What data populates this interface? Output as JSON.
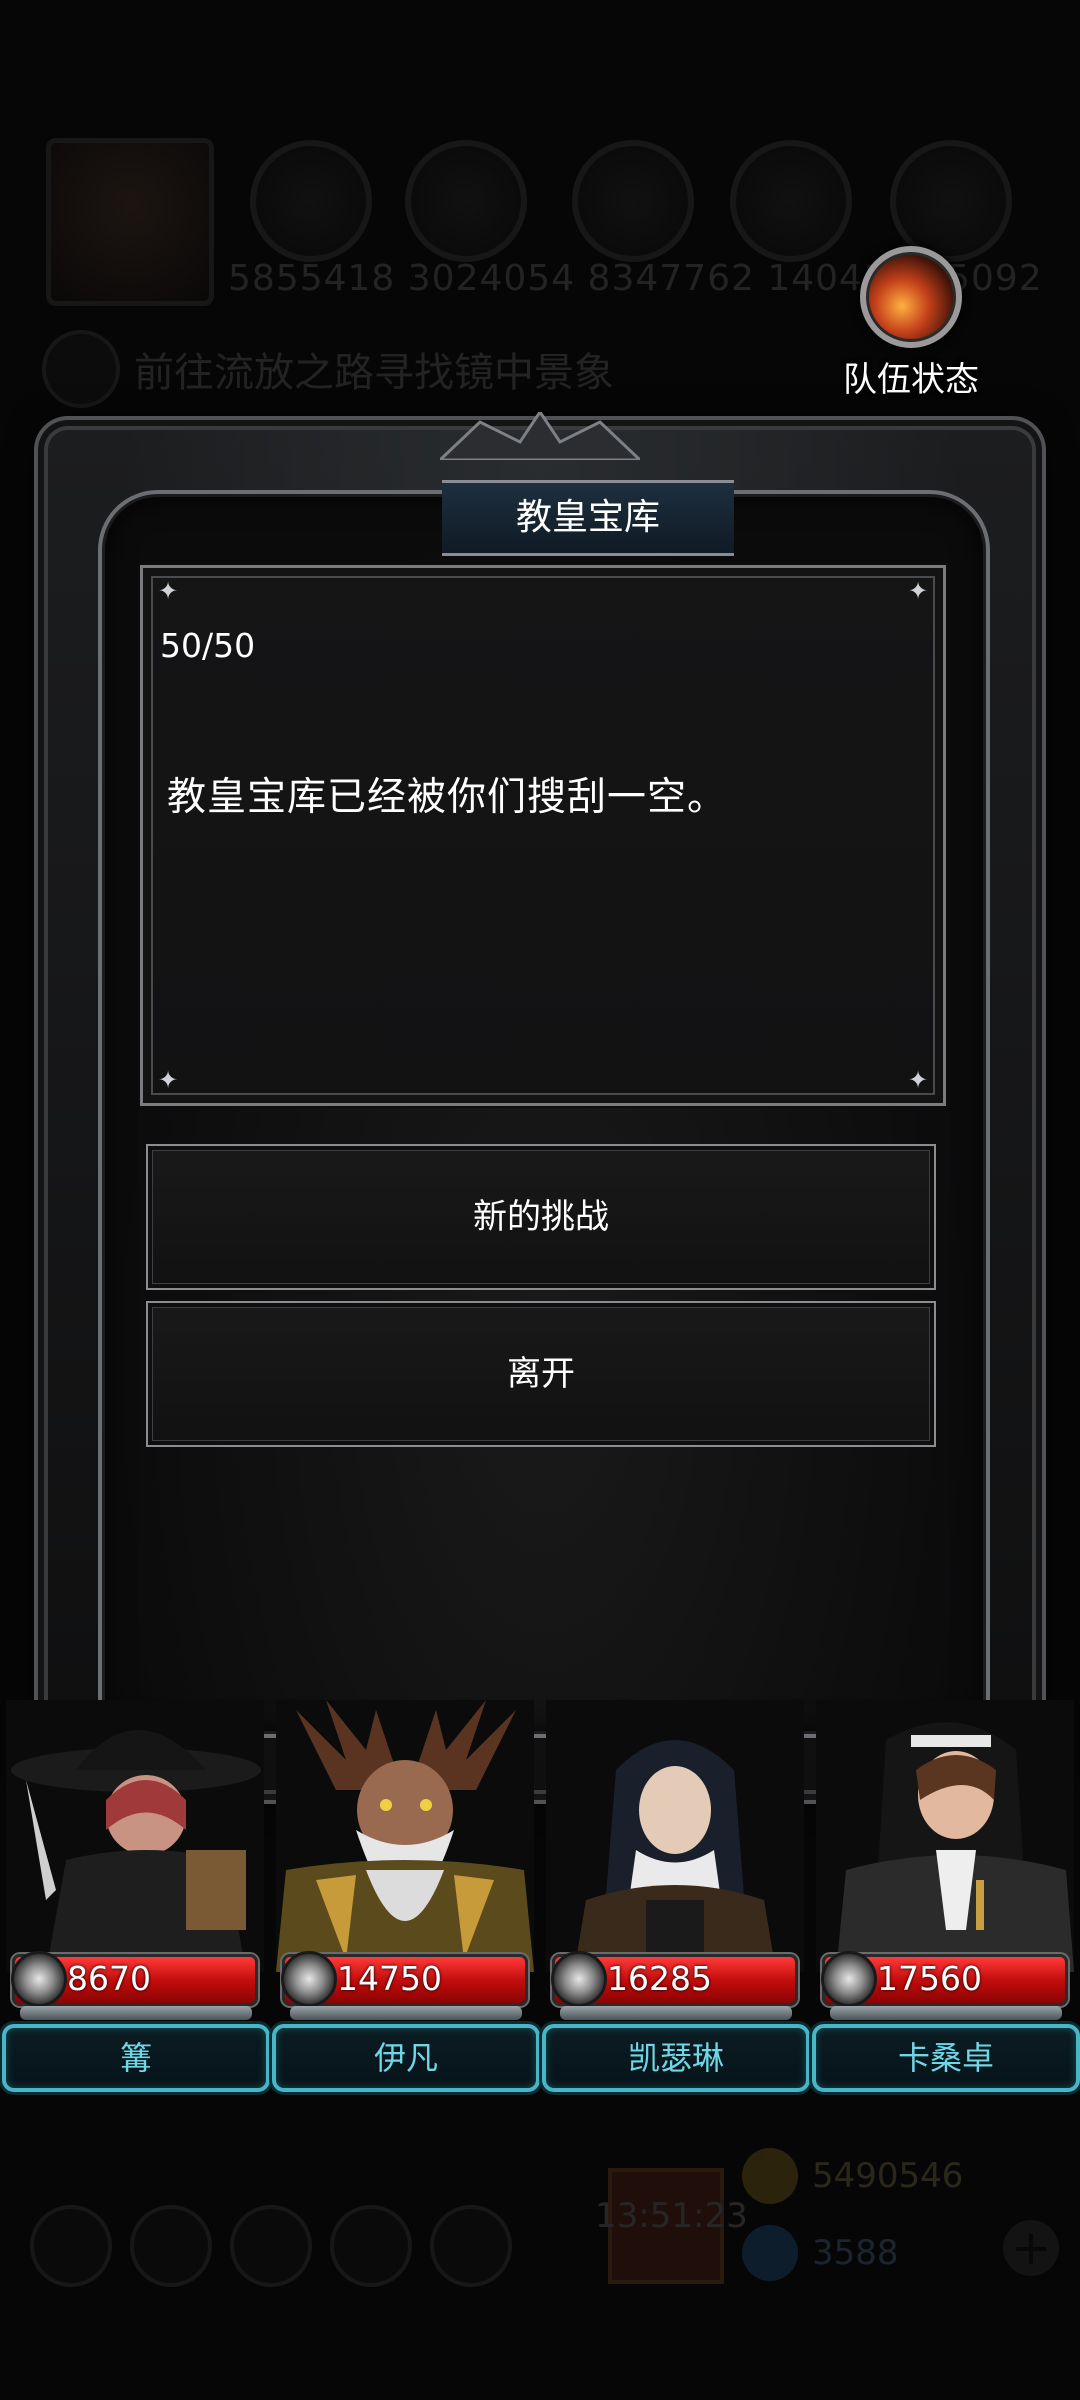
{
  "background": {
    "resource_values": "5855418 3024054 8347762 1404145 5092",
    "quest_text": "前往流放之路寻找镜中景象",
    "timer": "13:51:23",
    "gold": "5490546",
    "gems": "3588"
  },
  "team_status": {
    "label": "队伍状态"
  },
  "dialog": {
    "title": "教皇宝库",
    "progress": "50/50",
    "message": "教皇宝库已经被你们搜刮一空。",
    "buttons": [
      {
        "label": "新的挑战"
      },
      {
        "label": "离开"
      }
    ]
  },
  "party": [
    {
      "name": "篝",
      "hp": "8670"
    },
    {
      "name": "伊凡",
      "hp": "14750"
    },
    {
      "name": "凯瑟琳",
      "hp": "16285"
    },
    {
      "name": "卡桑卓",
      "hp": "17560"
    }
  ],
  "colors": {
    "accent_teal": "#47b6c6",
    "hp_red": "#c40d0d",
    "title_banner": "#1e2f3e"
  }
}
